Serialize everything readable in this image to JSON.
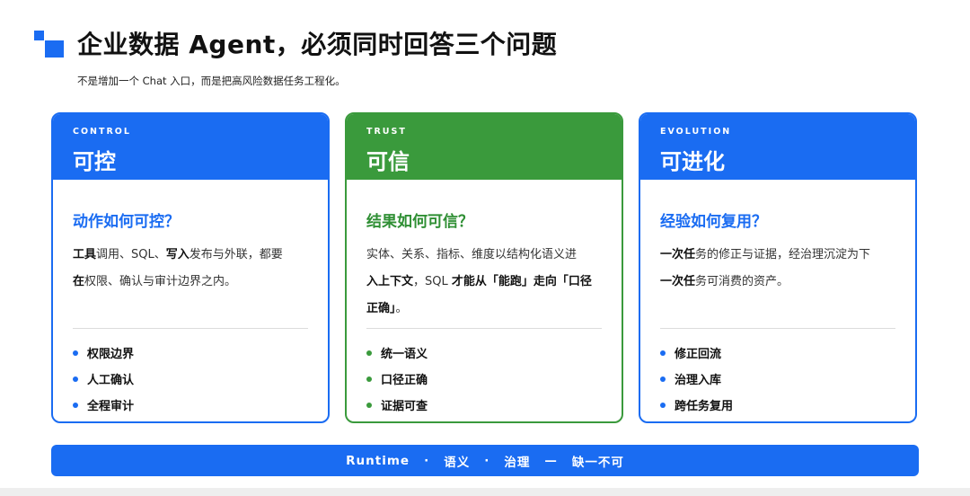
{
  "header": {
    "title": "企业数据 Agent，必须同时回答三个问题",
    "subtitle": "不是增加一个 Chat 入口，而是把高风险数据任务工程化。"
  },
  "cards": [
    {
      "tag": "CONTROL",
      "name": "可控",
      "question": "动作如何可控？",
      "desc_parts": [
        {
          "b": "工具",
          "t": "调用、SQL、"
        },
        {
          "b": "写入",
          "t": "发布与外联，都要"
        },
        {
          "b": "在",
          "t": "权限、确认与审计边界之内。"
        }
      ],
      "bullets": [
        "权限边界",
        "人工确认",
        "全程审计"
      ]
    },
    {
      "tag": "TRUST",
      "name": "可信",
      "question": "结果如何可信？",
      "desc_parts": [
        {
          "b": "",
          "t": "实体、关系、指标、维度以结构化语义进"
        },
        {
          "b": "入上下文",
          "t": "，SQL "
        },
        {
          "b": "才能从「能跑」走向「口径正确」",
          "t": "。"
        }
      ],
      "bullets": [
        "统一语义",
        "口径正确",
        "证据可查"
      ]
    },
    {
      "tag": "EVOLUTION",
      "name": "可进化",
      "question": "经验如何复用？",
      "desc_parts": [
        {
          "b": "一次任",
          "t": "务的修正与证据，经治理沉淀为下"
        },
        {
          "b": "一次任",
          "t": "务可消费的资产。"
        },
        {
          "b": "",
          "t": ""
        }
      ],
      "bullets": [
        "修正回流",
        "治理入库",
        "跨任务复用"
      ]
    }
  ],
  "footer": {
    "p1": "Runtime",
    "sep1": "·",
    "p2": "语义",
    "sep2": "·",
    "p3": "治理",
    "sep3": "—",
    "p4": "缺一不可"
  },
  "colors": {
    "blue": "#1a6cf2",
    "green": "#3a9a3c"
  },
  "icons": [
    "square-logo-icon",
    "bullet-dot-icon"
  ]
}
